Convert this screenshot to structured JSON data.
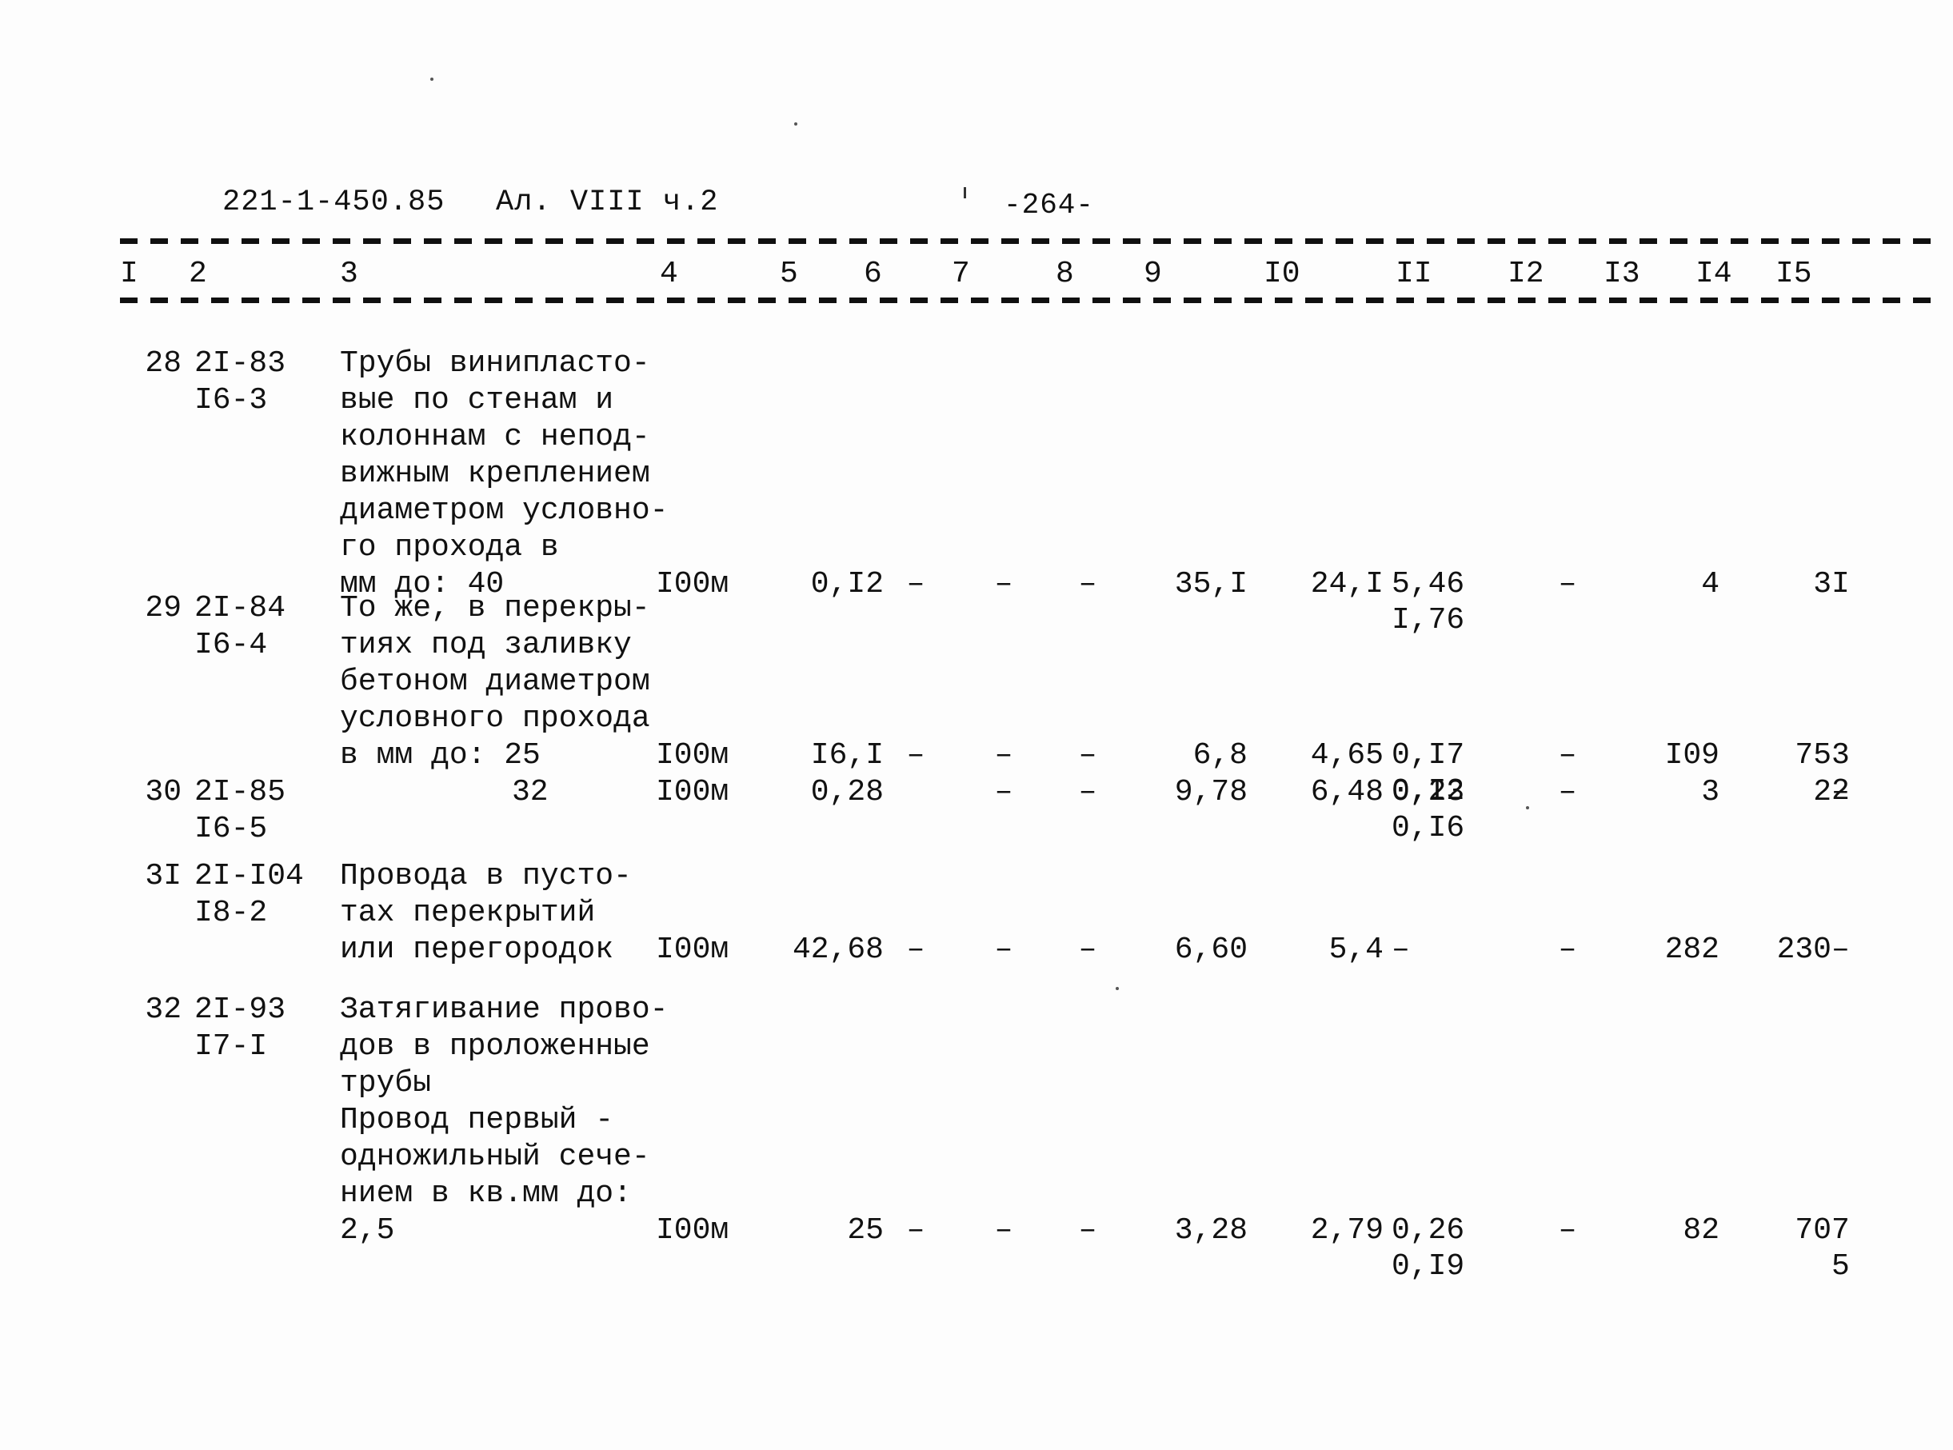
{
  "header": {
    "doc_code": "221-1-450.85",
    "album_ref": "Ал. VIII ч.2",
    "page_number": "-264-"
  },
  "table": {
    "column_headers": [
      "I",
      "2",
      "3",
      "4",
      "5",
      "6",
      "7",
      "8",
      "9",
      "I0",
      "II",
      "I2",
      "I3",
      "I4",
      "I5"
    ],
    "rows": [
      {
        "c1": "28",
        "c2_line1": "2I-83",
        "c2_line2": "I6-3",
        "c3": "Трубы винипласто-\nвые по стенам и\nколоннам с непод-\nвижным креплением\nдиаметром условно-\nго прохода в\nмм до: 40",
        "c4": "I00м",
        "c5": "0,I2",
        "c6": "–",
        "c7": "–",
        "c8": "–",
        "c9": "35,I",
        "c10": "24,I",
        "c11_top": "5,46",
        "c11_bottom": "I,76",
        "c12": "–",
        "c13": "4",
        "c14": "3",
        "c15_top": "I",
        "c15_bottom": ""
      },
      {
        "c1": "29",
        "c2_line1": "2I-84",
        "c2_line2": "I6-4",
        "c3": "То же, в перекры-\nтиях под заливку\nбетоном диаметром\nусловного прохода\nв мм до: 25",
        "c4": "I00м",
        "c5": "I6,I",
        "c6": "–",
        "c7": "–",
        "c8": "–",
        "c9": "6,8",
        "c10": "4,65",
        "c11_top": "0,I7",
        "c11_bottom": "0,I2",
        "c12": "–",
        "c13": "I09",
        "c14": "75",
        "c15_top": "3",
        "c15_bottom": "2"
      },
      {
        "c1": "30",
        "c2_line1": "2I-85",
        "c2_line2": "I6-5",
        "c3": "32",
        "c4": "I00м",
        "c5": "0,28",
        "c6": "",
        "c7": "–",
        "c8": "–",
        "c9": "9,78",
        "c10": "6,48",
        "c11_top": "0,23",
        "c11_bottom": "0,I6",
        "c12": "–",
        "c13": "3",
        "c14": "2",
        "c15_top": "–",
        "c15_bottom": ""
      },
      {
        "c1": "3I",
        "c2_line1": "2I-I04",
        "c2_line2": "I8-2",
        "c3": "Провода в пусто-\nтах перекрытий\nили перегородок",
        "c4": "I00м",
        "c5": "42,68",
        "c6": "–",
        "c7": "–",
        "c8": "–",
        "c9": "6,60",
        "c10": "5,4",
        "c11_top": "–",
        "c11_bottom": "",
        "c12": "–",
        "c13": "282",
        "c14": "230",
        "c15_top": "–",
        "c15_bottom": ""
      },
      {
        "c1": "32",
        "c2_line1": "2I-93",
        "c2_line2": "I7-I",
        "c3": "Затягивание прово-\nдов в проложенные\nтрубы\nПровод первый -\nодножильный сече-\nнием в кв.мм до:\n2,5",
        "c4": "I00м",
        "c5": "25",
        "c6": "–",
        "c7": "–",
        "c8": "–",
        "c9": "3,28",
        "c10": "2,79",
        "c11_top": "0,26",
        "c11_bottom": "0,I9",
        "c12": "–",
        "c13": "82",
        "c14": "70",
        "c15_top": "7",
        "c15_bottom": "5"
      }
    ]
  }
}
